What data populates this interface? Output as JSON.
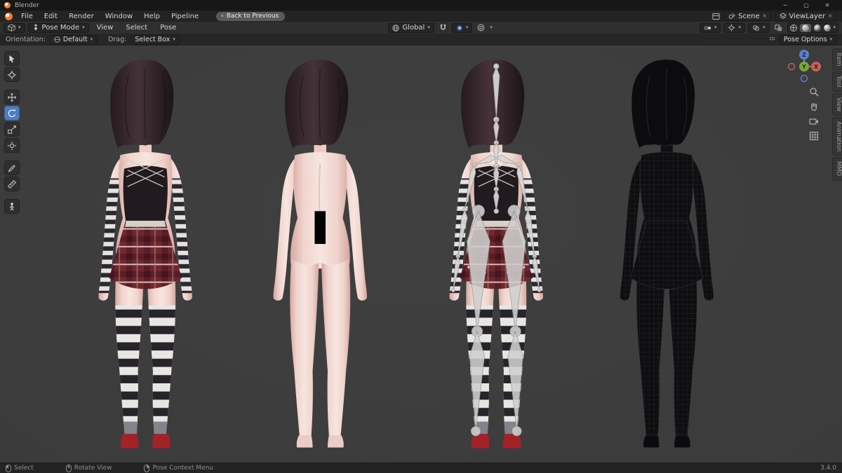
{
  "window": {
    "title": "Blender",
    "controls": {
      "minimize": "─",
      "maximize": "▢",
      "close": "✕"
    }
  },
  "topbar": {
    "menus": [
      "File",
      "Edit",
      "Render",
      "Window",
      "Help",
      "Pipeline"
    ],
    "back_button": "Back to Previous",
    "scene": "Scene",
    "view_layer": "ViewLayer"
  },
  "viewport_header": {
    "mode": "Pose Mode",
    "menus": [
      "View",
      "Select",
      "Pose"
    ],
    "orientation": "Global"
  },
  "tool_settings": {
    "orientation_label": "Orientation:",
    "orientation_value": "Default",
    "drag_label": "Drag:",
    "drag_value": "Select Box",
    "pose_options": "Pose Options"
  },
  "left_toolbar": {
    "tools": [
      "select-box",
      "cursor",
      "move",
      "rotate",
      "scale",
      "transform",
      "annotate",
      "measure",
      "pose-tool"
    ],
    "active_tool": "rotate"
  },
  "axis_gizmo": {
    "x": "X",
    "y": "Y",
    "z": "Z"
  },
  "side_tabs": [
    "Item",
    "Tool",
    "View",
    "Animation",
    "MMD"
  ],
  "status_bar": {
    "hints": [
      "Select",
      "Rotate View",
      "Pose Context Menu"
    ],
    "version": "3.4.0"
  },
  "icons": {
    "chevron_down": "▾",
    "back_arrow": "‹",
    "close_x": "✕"
  },
  "colors": {
    "accent": "#4f7cc0",
    "viewport_bg": "#3d3d3d",
    "skin": "#f2d8d2",
    "skirt_red": "#73262e"
  }
}
